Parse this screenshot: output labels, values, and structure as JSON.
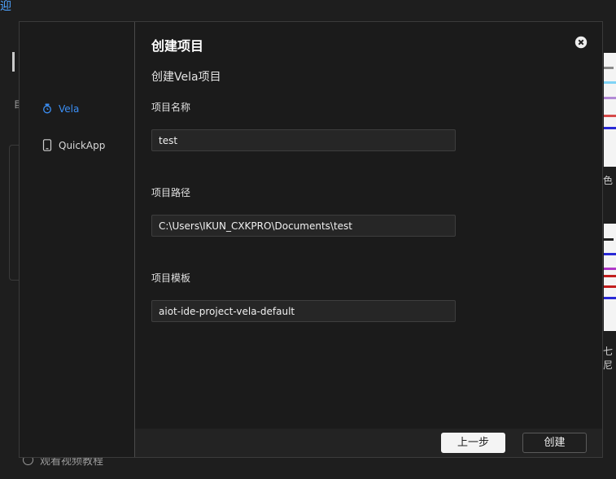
{
  "background": {
    "top_link": "迎",
    "bottom_text": "观看视频教程",
    "caption_1": "色",
    "caption_2": "七尼",
    "thumb1_bars": [
      "#8a8a8a",
      "#7fd3f5",
      "#b38ad6",
      "#d64a4a",
      "#2a2ad6"
    ],
    "thumb2_bars": [
      "#222222",
      "#2a2ad6",
      "#b038c8",
      "#c21e1e",
      "#c21e1e",
      "#2a2ad6"
    ]
  },
  "sidebar": {
    "items": [
      {
        "label": "Vela",
        "icon": "watch-icon",
        "active": true
      },
      {
        "label": "QuickApp",
        "icon": "phone-icon",
        "active": false
      }
    ]
  },
  "dialog": {
    "title": "创建项目",
    "subtitle": "创建Vela项目",
    "fields": {
      "name": {
        "label": "项目名称",
        "value": "test"
      },
      "path": {
        "label": "项目路径",
        "value": "C:\\Users\\IKUN_CXKPRO\\Documents\\test"
      },
      "template": {
        "label": "项目模板",
        "value": "aiot-ide-project-vela-default"
      }
    },
    "buttons": {
      "prev": "上一步",
      "create": "创建"
    }
  },
  "colors": {
    "accent": "#3b8ff5",
    "dialog_bg": "#1b1b1b",
    "input_bg": "#262626"
  }
}
